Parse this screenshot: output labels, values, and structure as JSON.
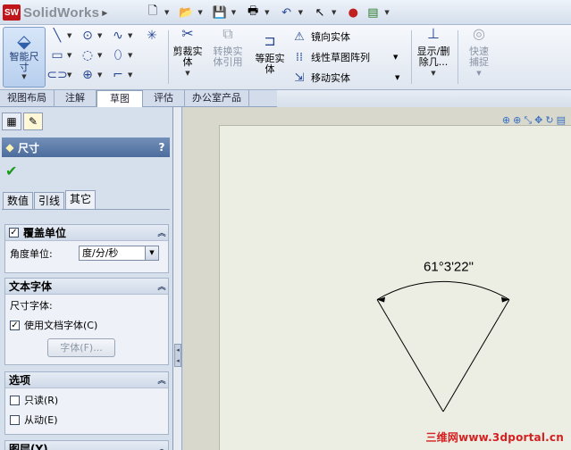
{
  "app": {
    "logo_badge": "SW",
    "title": "SolidWorks"
  },
  "quickbar": {
    "icons": [
      "new-document-icon",
      "open-folder-icon",
      "save-icon",
      "print-icon",
      "undo-icon",
      "select-cursor-icon",
      "traffic-light-icon",
      "options-icon"
    ]
  },
  "ribbon": {
    "smart_dimension": "智能尺寸",
    "trim": "剪裁实体",
    "convert": "转换实体引用",
    "offset": "等距实体",
    "mirror": "镜向实体",
    "linear_pattern": "线性草图阵列",
    "move": "移动实体",
    "show_hide": "显示/删除几...",
    "quick_snap": "快速捕捉"
  },
  "command_tabs": [
    {
      "label": "视图布局",
      "active": false
    },
    {
      "label": "注解",
      "active": false
    },
    {
      "label": "草图",
      "active": true
    },
    {
      "label": "评估",
      "active": false
    },
    {
      "label": "办公室产品",
      "active": false
    }
  ],
  "property_manager": {
    "title": "尺寸",
    "help": "?",
    "tabs": [
      {
        "label": "数值",
        "active": false
      },
      {
        "label": "引线",
        "active": false
      },
      {
        "label": "其它",
        "active": true
      }
    ],
    "override_units": {
      "title": "覆盖单位",
      "checked": true,
      "angle_label": "角度单位:",
      "angle_value": "度/分/秒"
    },
    "text_font": {
      "title": "文本字体",
      "dim_font_label": "尺寸字体:",
      "use_doc_font": "使用文档字体(C)",
      "use_doc_font_checked": true,
      "font_button": "字体(F)..."
    },
    "options": {
      "title": "选项",
      "readonly": "只读(R)",
      "driven": "从动(E)"
    },
    "layer_title": "图层(Y)"
  },
  "drawing": {
    "dimension_text": "61°3'22\"",
    "angle_deg": 61.056
  },
  "watermark": "三维网www.3dportal.cn",
  "colors": {
    "ribbon_blue": "#2b4a94",
    "header_blue": "#4c6c9c",
    "ok_green": "#1a9b1a",
    "watermark_red": "#d42020"
  }
}
